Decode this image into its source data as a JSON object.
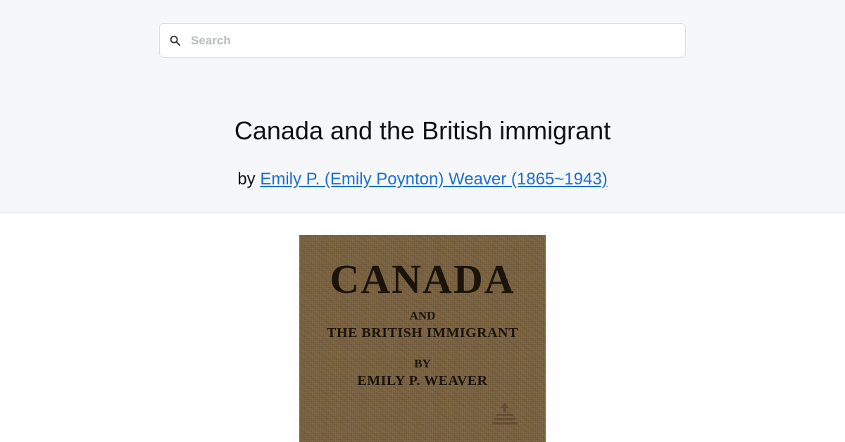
{
  "search": {
    "placeholder": "Search",
    "icon": "search-icon"
  },
  "book": {
    "title": "Canada and the British immigrant",
    "by_prefix": "by",
    "author_link": "Emily P. (Emily Poynton) Weaver (1865~1943)"
  },
  "cover": {
    "line1": "CANADA",
    "line2": "AND",
    "line3": "THE BRITISH IMMIGRANT",
    "line4": "BY",
    "line5": "EMILY P. WEAVER"
  },
  "colors": {
    "header_bg": "#f6f7f9",
    "link": "#1a6fd0",
    "cover_cloth": "#7a6240"
  }
}
